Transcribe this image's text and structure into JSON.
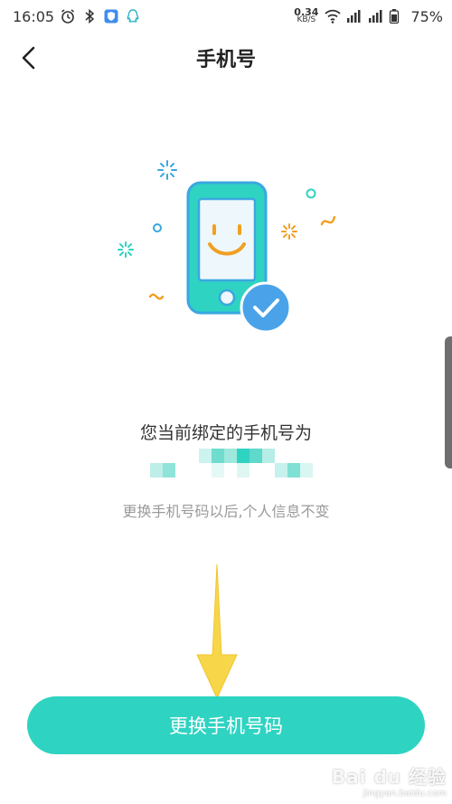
{
  "status_bar": {
    "time": "16:05",
    "net_speed_value": "0.34",
    "net_speed_unit": "KB/S",
    "battery": "75%"
  },
  "header": {
    "title": "手机号"
  },
  "main": {
    "bound_label": "您当前绑定的手机号为",
    "hint": "更换手机号码以后,个人信息不变"
  },
  "actions": {
    "change_button": "更换手机号码"
  },
  "watermark": {
    "brand": "Bai du 经验",
    "url": "jingyan.baidu.com"
  },
  "colors": {
    "accent": "#2fd3c2",
    "phone_body": "#2fd3c2",
    "check_badge": "#4aa3e8",
    "smile": "#f0a020",
    "arrow": "#f7d64a"
  }
}
